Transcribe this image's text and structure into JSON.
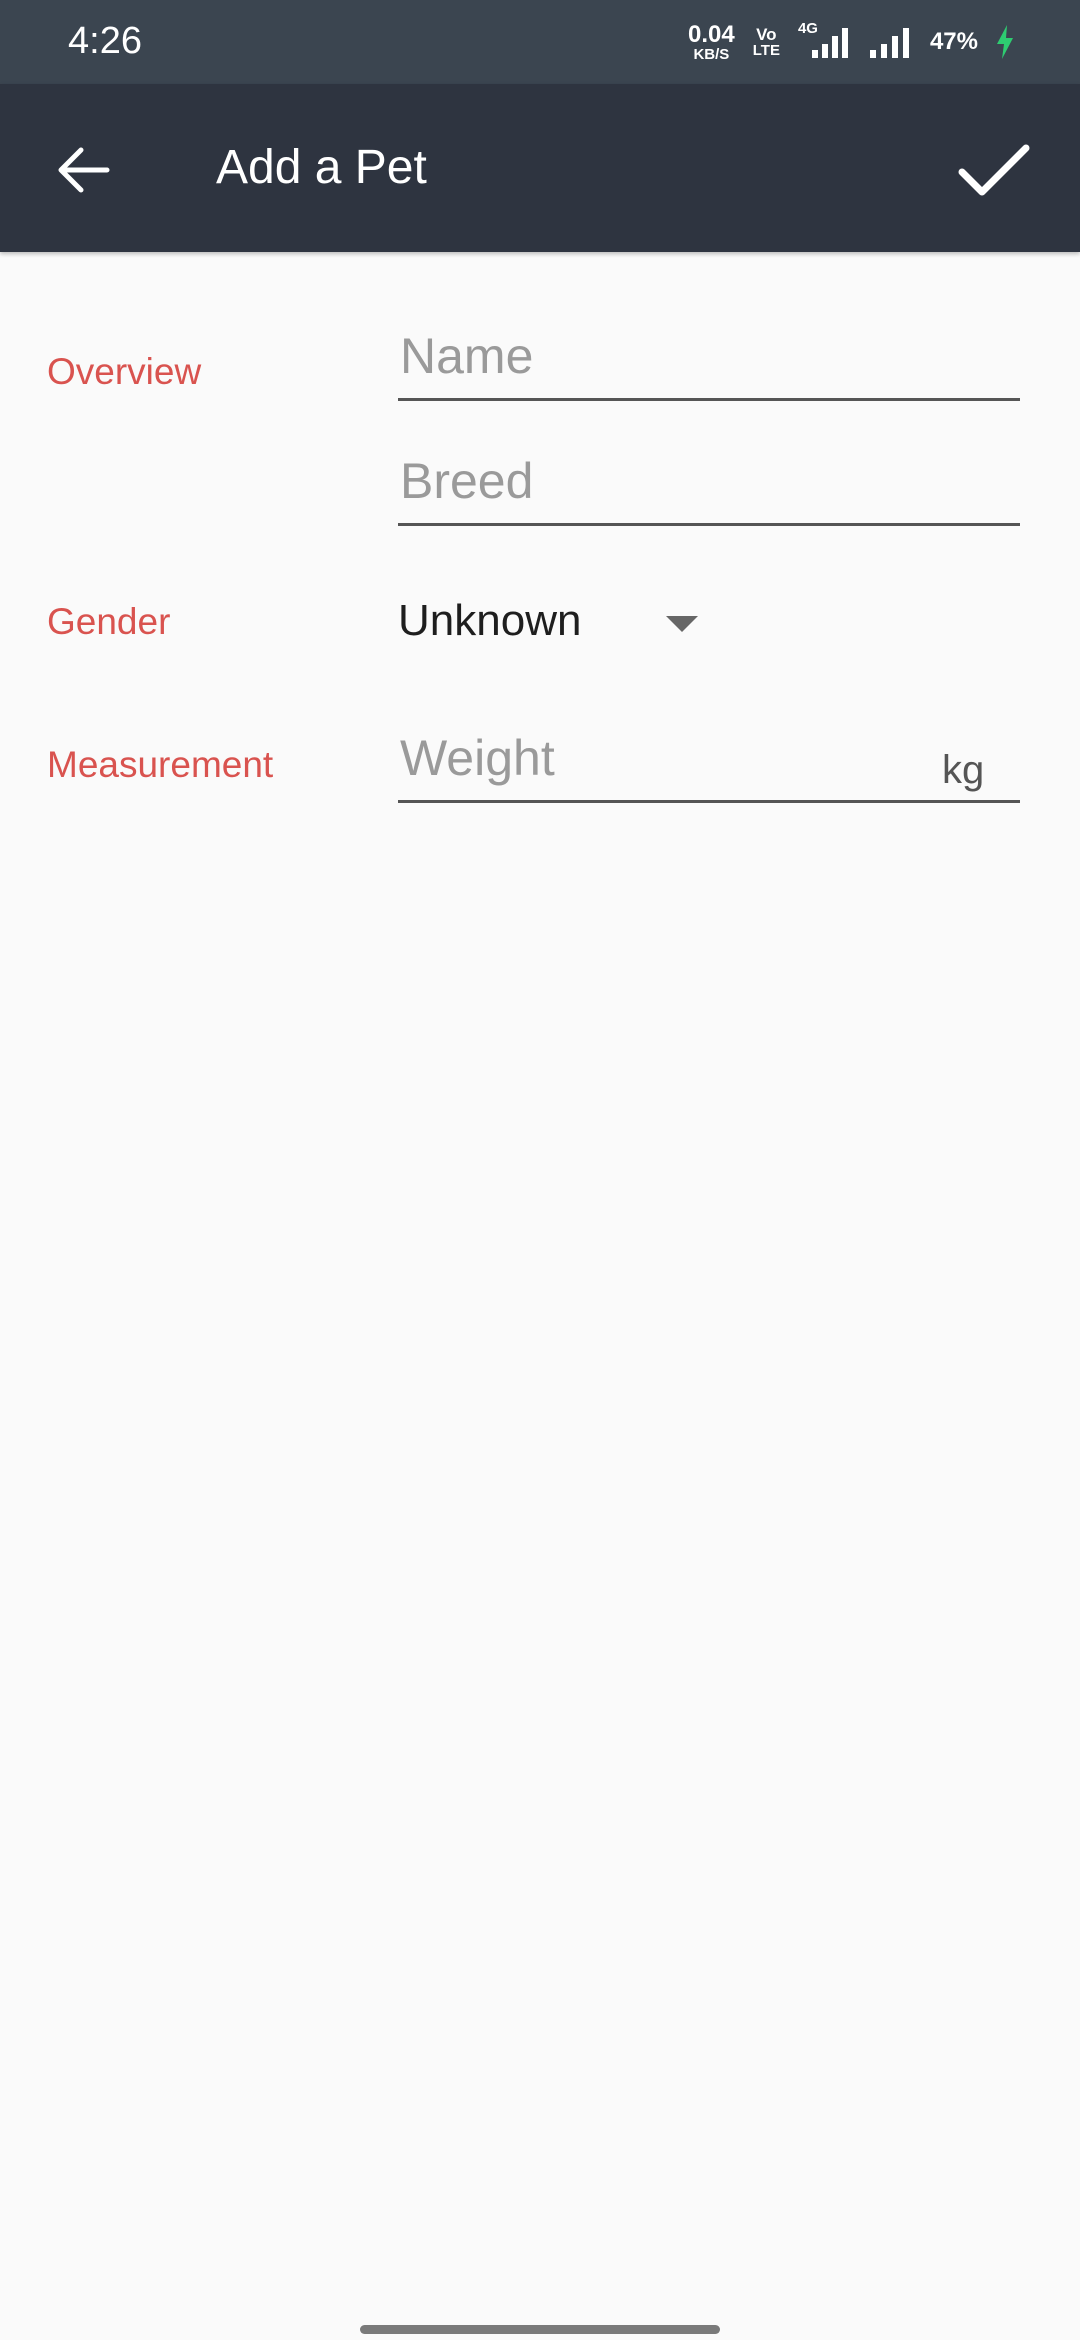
{
  "status_bar": {
    "time": "4:26",
    "net_speed_value": "0.04",
    "net_speed_unit": "KB/S",
    "volte_top": "Vo",
    "volte_bottom": "LTE",
    "network_type": "4G",
    "battery_percent": "47%",
    "battery_charging_color": "#2ecc71"
  },
  "app_bar": {
    "title": "Add a Pet",
    "back_icon": "arrow-left-icon",
    "confirm_icon": "check-icon",
    "background": "#2e3440"
  },
  "form": {
    "overview_label": "Overview",
    "name_placeholder": "Name",
    "name_value": "",
    "breed_placeholder": "Breed",
    "breed_value": "",
    "gender_label": "Gender",
    "gender_selected": "Unknown",
    "measurement_label": "Measurement",
    "weight_placeholder": "Weight",
    "weight_value": "",
    "weight_unit": "kg",
    "label_color": "#d9534f"
  }
}
